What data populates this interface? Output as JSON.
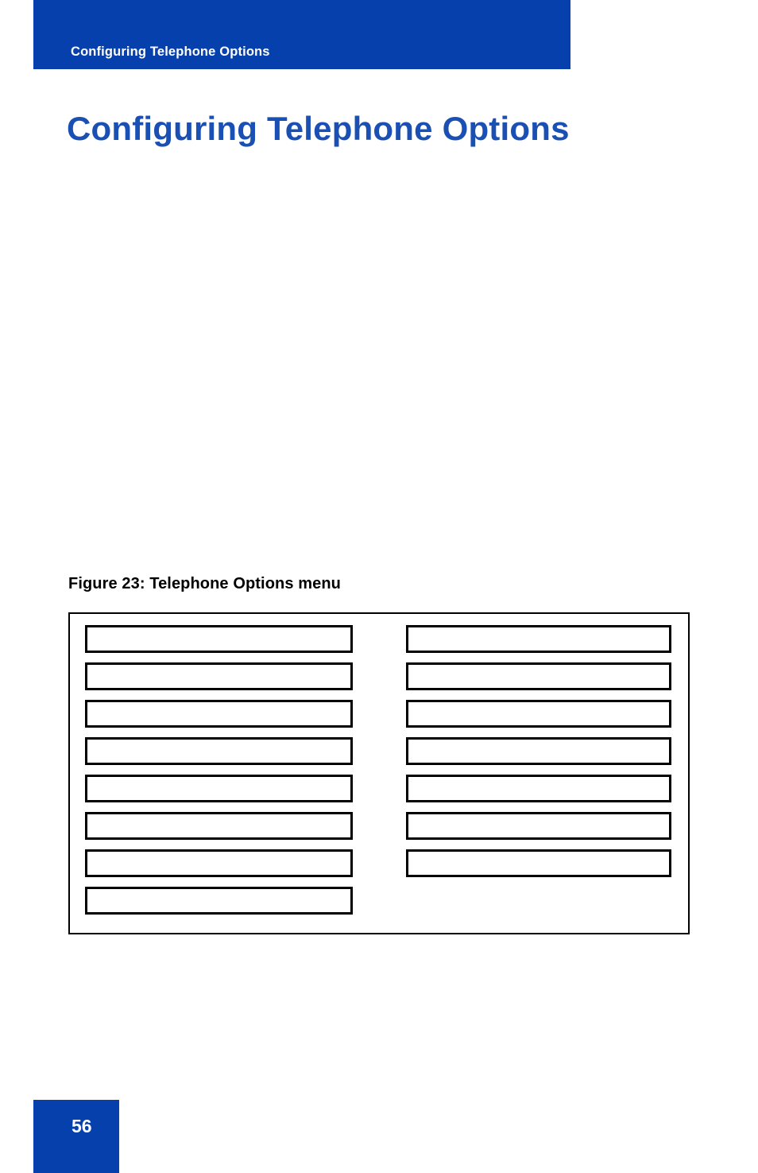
{
  "page": {
    "running_header": "Configuring Telephone Options",
    "chapter_title": "Configuring Telephone Options",
    "page_number": "56",
    "colors": {
      "brand_blue": "#0540AD",
      "title_blue": "#1A4FB4",
      "rule_black": "#000000",
      "page_background": "#ffffff"
    }
  },
  "figure": {
    "caption": "Figure 23: Telephone Options menu",
    "menu_columns": {
      "left": [
        {
          "label": ""
        },
        {
          "label": ""
        },
        {
          "label": ""
        },
        {
          "label": ""
        },
        {
          "label": ""
        },
        {
          "label": ""
        },
        {
          "label": ""
        },
        {
          "label": ""
        }
      ],
      "right": [
        {
          "label": ""
        },
        {
          "label": ""
        },
        {
          "label": ""
        },
        {
          "label": ""
        },
        {
          "label": ""
        },
        {
          "label": ""
        },
        {
          "label": ""
        }
      ]
    }
  }
}
